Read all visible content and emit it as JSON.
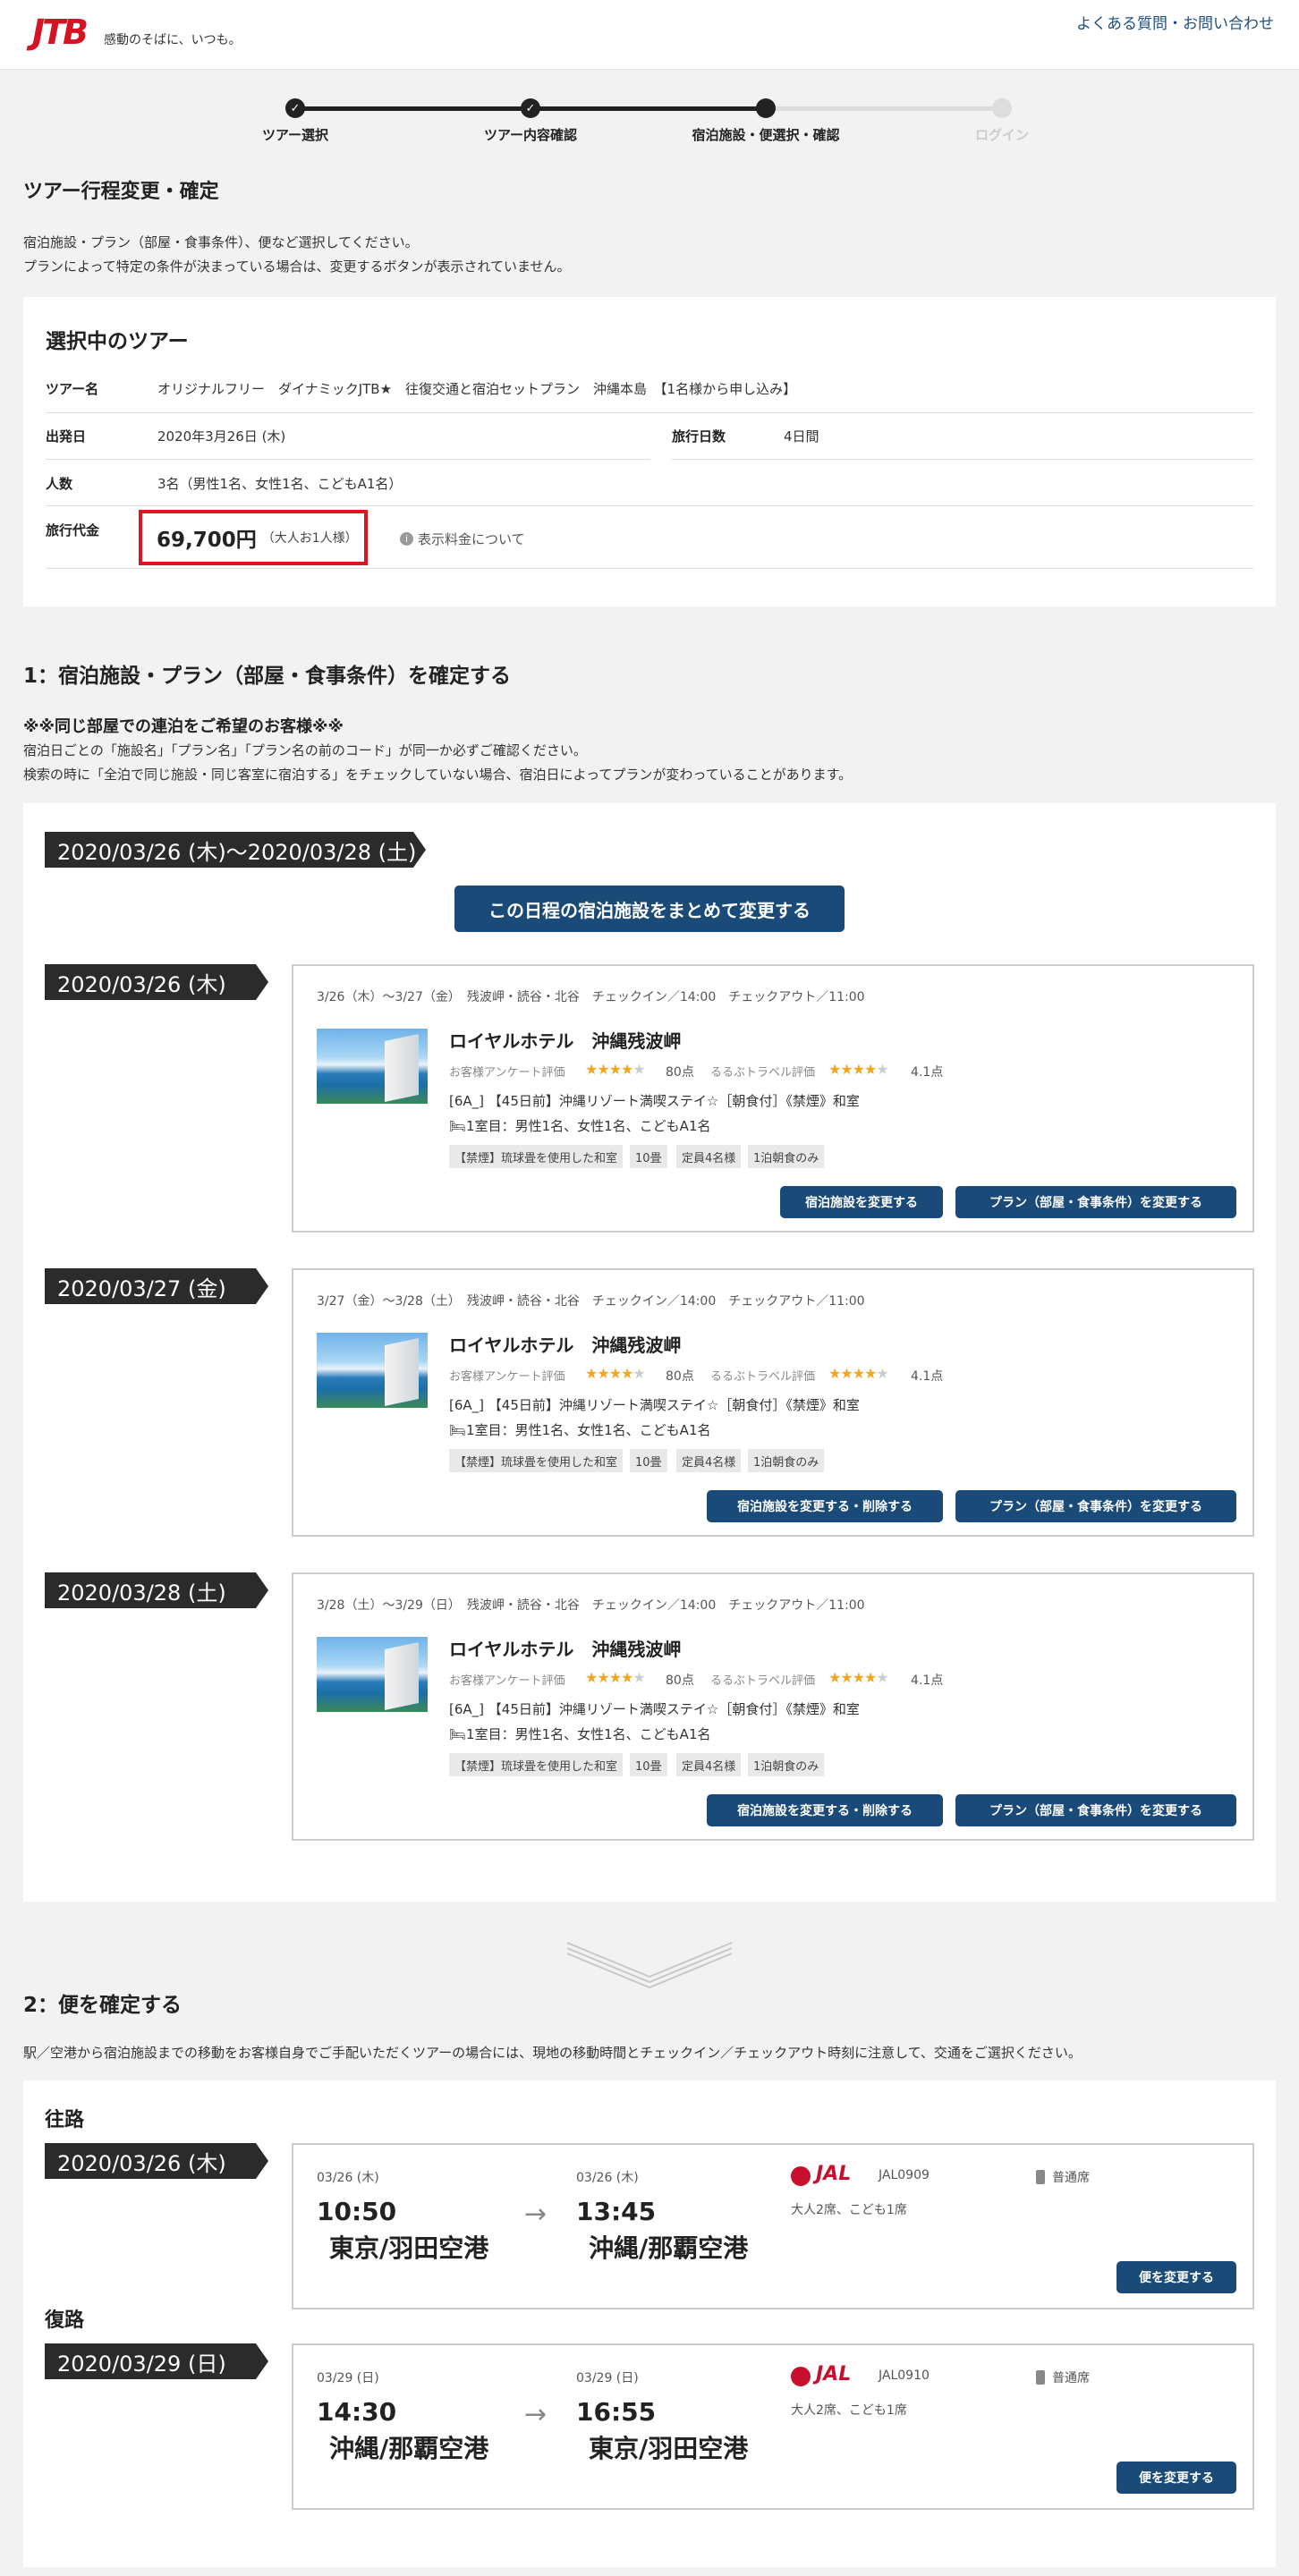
{
  "header": {
    "logo": "JTB",
    "tagline": "感動のそばに、いつも。",
    "faq_link": "よくある質問・お問い合わせ"
  },
  "steps": [
    {
      "label": "ツアー選択",
      "state": "done"
    },
    {
      "label": "ツアー内容確認",
      "state": "done"
    },
    {
      "label": "宿泊施設・便選択・確認",
      "state": "current"
    },
    {
      "label": "ログイン",
      "state": "todo"
    }
  ],
  "page": {
    "title": "ツアー行程変更・確定",
    "intro_1": "宿泊施設・プラン（部屋・食事条件）、便など選択してください。",
    "intro_2": "プランによって特定の条件が決まっている場合は、変更するボタンが表示されていません。"
  },
  "tour": {
    "heading": "選択中のツアー",
    "name_label": "ツアー名",
    "name": "オリジナルフリー　ダイナミックJTB★　往復交通と宿泊セットプラン　沖縄本島　【1名様から申し込み】",
    "departure_label": "出発日",
    "departure": "2020年3月26日 (木)",
    "days_label": "旅行日数",
    "days": "4日間",
    "people_label": "人数",
    "people": "3名（男性1名、女性1名、こどもA1名）",
    "price_label": "旅行代金",
    "price": "69,700円",
    "price_note": "（大人お1人様）",
    "price_info": "表示料金について"
  },
  "hotel_section": {
    "title": "1：宿泊施設・プラン（部屋・食事条件）を確定する",
    "notice_title": "※※同じ部屋での連泊をご希望のお客様※※",
    "notice_1": "宿泊日ごとの「施設名」「プラン名」「プラン名の前のコード」が同一か必ずご確認ください。",
    "notice_2": "検索の時に「全泊で同じ施設・同じ客室に宿泊する」をチェックしていない場合、宿泊日によってプランが変わっていることがあります。",
    "range_tag": "2020/03/26 (木)〜2020/03/28 (土)",
    "bulk_button": "この日程の宿泊施設をまとめて変更する",
    "nights": [
      {
        "date_tag": "2020/03/26 (木)",
        "info": "3/26（木）〜3/27（金）　残波岬・読谷・北谷　チェックイン／14:00　チェックアウト／11:00",
        "hotel": "ロイヤルホテル　沖縄残波岬",
        "survey_label": "お客様アンケート評価",
        "survey_score": "80点",
        "rurubu_label": "るるぶトラベル評価",
        "rurubu_score": "4.1点",
        "plan": "[6A_] 【45日前】沖縄リゾート満喫ステイ☆［朝食付］《禁煙》和室",
        "room": "1室目：男性1名、女性1名、こどもA1名",
        "tags": [
          "【禁煙】琉球畳を使用した和室",
          "10畳",
          "定員4名様",
          "1泊朝食のみ"
        ],
        "btn_change": "宿泊施設を変更する",
        "btn_plan": "プラン（部屋・食事条件）を変更する"
      },
      {
        "date_tag": "2020/03/27 (金)",
        "info": "3/27（金）〜3/28（土）　残波岬・読谷・北谷　チェックイン／14:00　チェックアウト／11:00",
        "hotel": "ロイヤルホテル　沖縄残波岬",
        "survey_label": "お客様アンケート評価",
        "survey_score": "80点",
        "rurubu_label": "るるぶトラベル評価",
        "rurubu_score": "4.1点",
        "plan": "[6A_] 【45日前】沖縄リゾート満喫ステイ☆［朝食付］《禁煙》和室",
        "room": "1室目：男性1名、女性1名、こどもA1名",
        "tags": [
          "【禁煙】琉球畳を使用した和室",
          "10畳",
          "定員4名様",
          "1泊朝食のみ"
        ],
        "btn_change": "宿泊施設を変更する・削除する",
        "btn_plan": "プラン（部屋・食事条件）を変更する"
      },
      {
        "date_tag": "2020/03/28 (土)",
        "info": "3/28（土）〜3/29（日）　残波岬・読谷・北谷　チェックイン／14:00　チェックアウト／11:00",
        "hotel": "ロイヤルホテル　沖縄残波岬",
        "survey_label": "お客様アンケート評価",
        "survey_score": "80点",
        "rurubu_label": "るるぶトラベル評価",
        "rurubu_score": "4.1点",
        "plan": "[6A_] 【45日前】沖縄リゾート満喫ステイ☆［朝食付］《禁煙》和室",
        "room": "1室目：男性1名、女性1名、こどもA1名",
        "tags": [
          "【禁煙】琉球畳を使用した和室",
          "10畳",
          "定員4名様",
          "1泊朝食のみ"
        ],
        "btn_change": "宿泊施設を変更する・削除する",
        "btn_plan": "プラン（部屋・食事条件）を変更する"
      }
    ]
  },
  "flight_section": {
    "title": "2：便を確定する",
    "note": "駅／空港から宿泊施設までの移動をお客様自身でご手配いただくツアーの場合には、現地の移動時間とチェックイン／チェックアウト時刻に注意して、交通をご選択ください。",
    "flights": [
      {
        "leg": "往路",
        "date_tag": "2020/03/26 (木)",
        "dep_date": "03/26 (木)",
        "dep_time": "10:50",
        "dep_airport": "東京/羽田空港",
        "arr_date": "03/26 (木)",
        "arr_time": "13:45",
        "arr_airport": "沖縄/那覇空港",
        "airline": "JAL",
        "flight_no": "JAL0909",
        "seats": "大人2席、こども1席",
        "seat_class": "普通席",
        "button": "便を変更する"
      },
      {
        "leg": "復路",
        "date_tag": "2020/03/29 (日)",
        "dep_date": "03/29 (日)",
        "dep_time": "14:30",
        "dep_airport": "沖縄/那覇空港",
        "arr_date": "03/29 (日)",
        "arr_time": "16:55",
        "arr_airport": "東京/羽田空港",
        "airline": "JAL",
        "flight_no": "JAL0910",
        "seats": "大人2席、こども1席",
        "seat_class": "普通席",
        "button": "便を変更する"
      }
    ]
  },
  "colors": {
    "brand_red": "#d41425",
    "button_blue": "#1a4a78",
    "link_blue": "#1d4f82",
    "star": "#f4a61f",
    "price_box": "#e0141e"
  }
}
